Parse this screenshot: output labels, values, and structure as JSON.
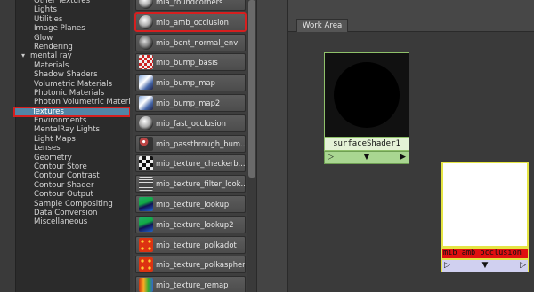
{
  "tree": {
    "items": [
      {
        "label": "Other Textures",
        "parent": false
      },
      {
        "label": "Lights",
        "parent": false
      },
      {
        "label": "Utilities",
        "parent": false
      },
      {
        "label": "Image Planes",
        "parent": false
      },
      {
        "label": "Glow",
        "parent": false
      },
      {
        "label": "Rendering",
        "parent": false
      },
      {
        "label": "mental ray",
        "parent": true
      },
      {
        "label": "Materials",
        "parent": false
      },
      {
        "label": "Shadow Shaders",
        "parent": false
      },
      {
        "label": "Volumetric Materials",
        "parent": false
      },
      {
        "label": "Photonic Materials",
        "parent": false
      },
      {
        "label": "Photon Volumetric Materi",
        "parent": false
      },
      {
        "label": "Textures",
        "parent": false,
        "selected": true
      },
      {
        "label": "Environments",
        "parent": false
      },
      {
        "label": "MentalRay Lights",
        "parent": false
      },
      {
        "label": "Light Maps",
        "parent": false
      },
      {
        "label": "Lenses",
        "parent": false
      },
      {
        "label": "Geometry",
        "parent": false
      },
      {
        "label": "Contour Store",
        "parent": false
      },
      {
        "label": "Contour Contrast",
        "parent": false
      },
      {
        "label": "Contour Shader",
        "parent": false
      },
      {
        "label": "Contour Output",
        "parent": false
      },
      {
        "label": "Sample Compositing",
        "parent": false
      },
      {
        "label": "Data Conversion",
        "parent": false
      },
      {
        "label": "Miscellaneous",
        "parent": false
      }
    ]
  },
  "nodes": {
    "items": [
      {
        "label": "mia_roundcorners",
        "icon": "sphere-icon"
      },
      {
        "label": "mib_amb_occlusion",
        "icon": "sphere-icon",
        "highlight": true
      },
      {
        "label": "mib_bent_normal_env",
        "icon": "sphere-icon"
      },
      {
        "label": "mib_bump_basis",
        "icon": "bump-icon"
      },
      {
        "label": "mib_bump_map",
        "icon": "map-icon"
      },
      {
        "label": "mib_bump_map2",
        "icon": "map-icon"
      },
      {
        "label": "mib_fast_occlusion",
        "icon": "sphere-icon"
      },
      {
        "label": "mib_passthrough_bum...",
        "icon": "passthrough-icon"
      },
      {
        "label": "mib_texture_checkerb...",
        "icon": "checker-icon"
      },
      {
        "label": "mib_texture_filter_look...",
        "icon": "lines-icon"
      },
      {
        "label": "mib_texture_lookup",
        "icon": "lookup-icon"
      },
      {
        "label": "mib_texture_lookup2",
        "icon": "lookup-icon"
      },
      {
        "label": "mib_texture_polkadot",
        "icon": "polka-icon"
      },
      {
        "label": "mib_texture_polkasphere",
        "icon": "polka-icon"
      },
      {
        "label": "mib_texture_remap",
        "icon": "remap-icon"
      }
    ]
  },
  "workarea": {
    "tab_label": "Work Area",
    "surface_node": {
      "name": "surfaceShader1",
      "port_in": "▷",
      "port_mid": "▼",
      "port_out": "▶"
    },
    "amb_node": {
      "name": "mib_amb_occlusion",
      "port_in": "▷",
      "port_mid": "▼",
      "port_out": "▷"
    }
  },
  "colors": {
    "selection_outline": "#d61f1f",
    "tree_selected_bg": "#5285a6",
    "surface_node_border": "#8fc16a",
    "amb_node_border": "#e5e544",
    "amb_label_bg": "#e01010"
  }
}
